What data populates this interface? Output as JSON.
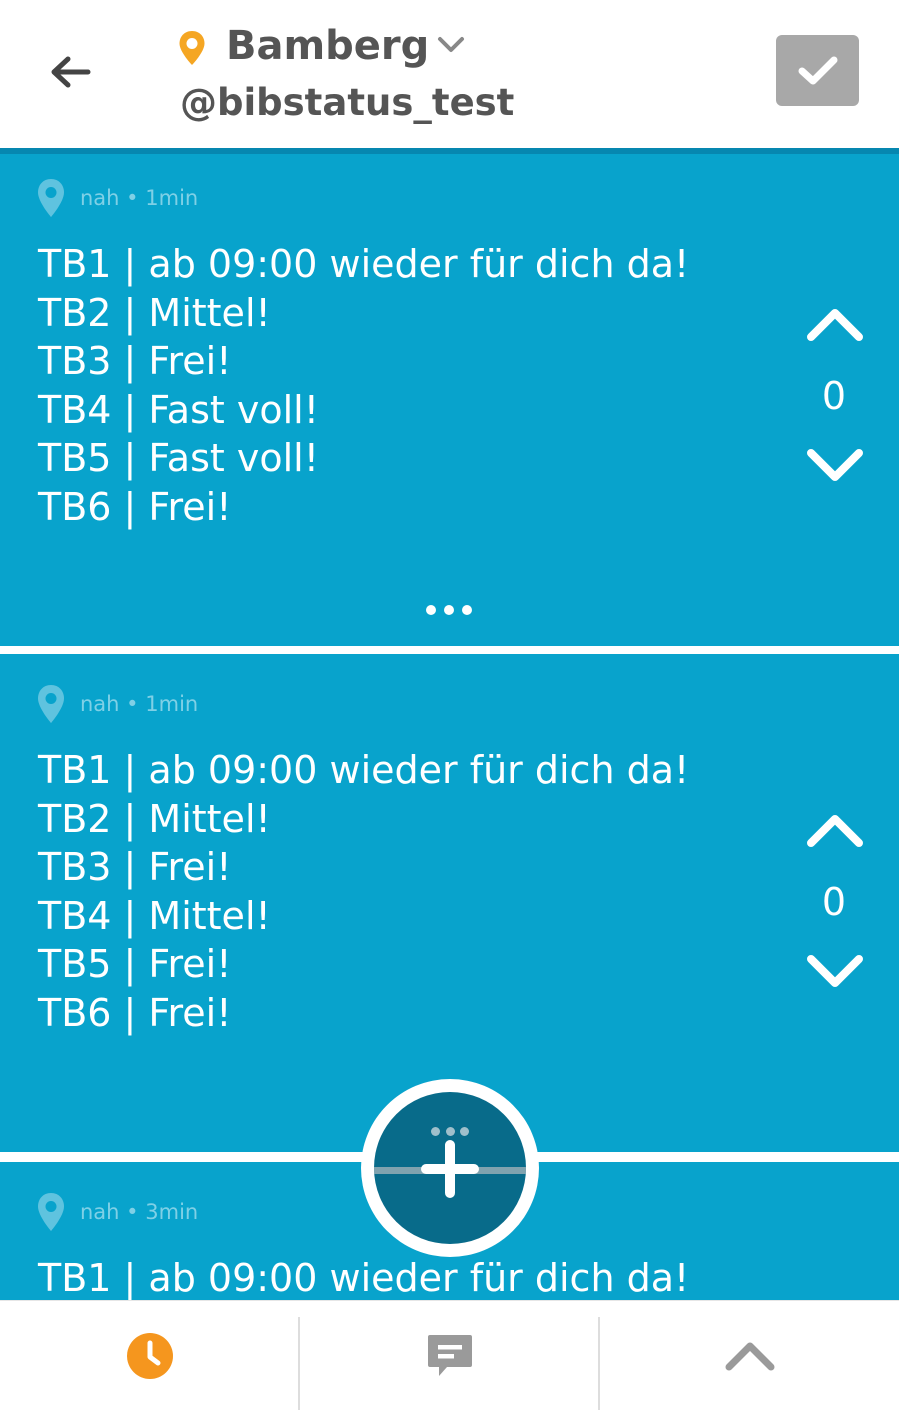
{
  "header": {
    "city": "Bamberg",
    "handle": "@bibstatus_test",
    "accent_color": "#f5a623",
    "icons": {
      "back": "arrow-left-icon",
      "location": "location-pin-icon",
      "dropdown": "chevron-down-icon",
      "confirm": "checkmark-icon"
    }
  },
  "feed": {
    "accent_color": "#08a3cc",
    "posts": [
      {
        "distance": "nah",
        "age": "1min",
        "lines": [
          "TB1 | ab 09:00 wieder für dich da!",
          "TB2 | Mittel!",
          "TB3 | Frei!",
          "TB4 | Fast voll!",
          "TB5 | Fast voll!",
          "TB6 | Frei!"
        ],
        "votes": "0"
      },
      {
        "distance": "nah",
        "age": "1min",
        "lines": [
          "TB1 | ab 09:00 wieder für dich da!",
          "TB2 | Mittel!",
          "TB3 | Frei!",
          "TB4 | Mittel!",
          "TB5 | Frei!",
          "TB6 | Frei!"
        ],
        "votes": "0"
      },
      {
        "distance": "nah",
        "age": "3min",
        "lines": [
          "TB1 | ab 09:00 wieder für dich da!"
        ],
        "votes": ""
      }
    ]
  },
  "fab": {
    "icon": "plus-icon",
    "color": "#086b8a"
  },
  "bottom_nav": {
    "items": [
      {
        "icon": "clock-icon",
        "active": true,
        "color": "#f5961e"
      },
      {
        "icon": "chat-icon",
        "active": false,
        "color": "#9a9a9a"
      },
      {
        "icon": "chevron-up-icon",
        "active": false,
        "color": "#9a9a9a"
      }
    ]
  }
}
